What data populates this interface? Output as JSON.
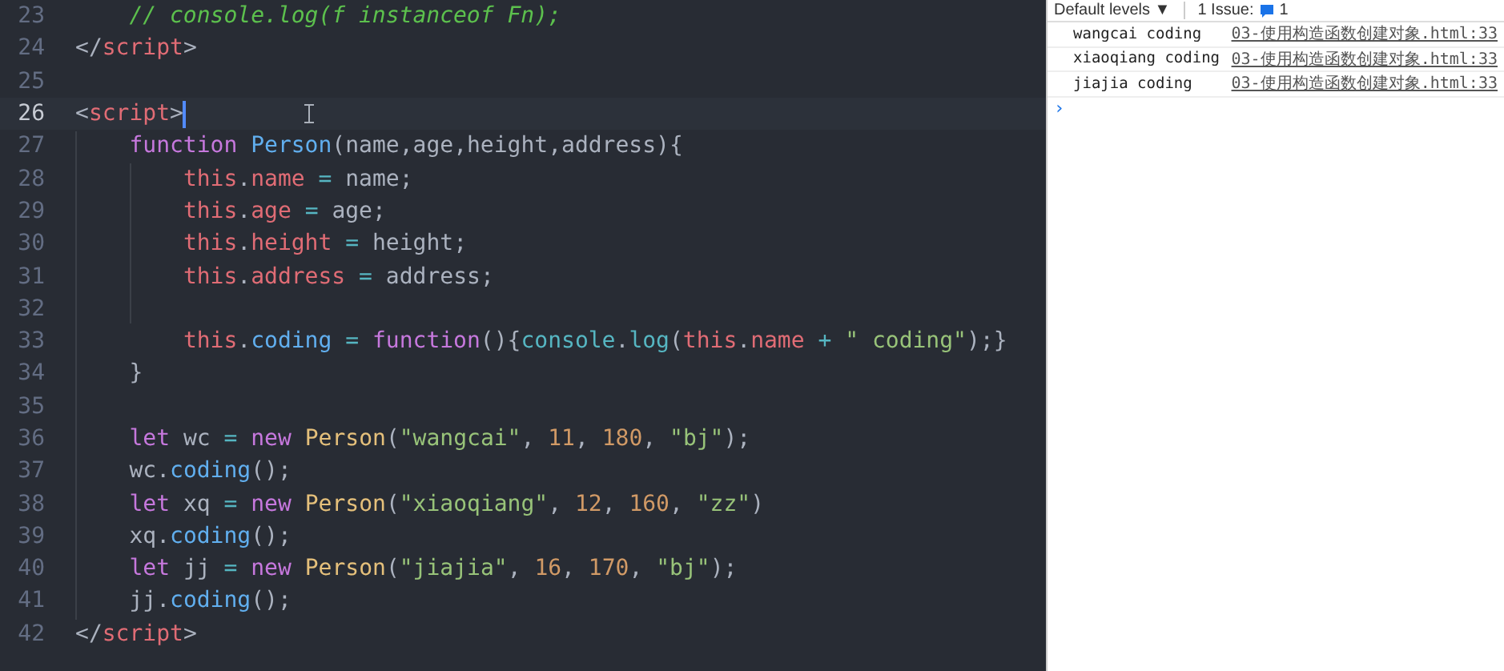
{
  "editor": {
    "lines": [
      {
        "number": "23",
        "current": false,
        "code": "    // console.log(f instanceof Fn);"
      },
      {
        "number": "24",
        "current": false,
        "code": "</script>"
      },
      {
        "number": "25",
        "current": false
      },
      {
        "number": "26",
        "current": true,
        "code": "<script>"
      },
      {
        "number": "27",
        "current": false,
        "code": "    function Person(name,age,height,address){"
      },
      {
        "number": "28",
        "current": false,
        "code": "        this.name = name;"
      },
      {
        "number": "29",
        "current": false,
        "code": "        this.age = age;"
      },
      {
        "number": "30",
        "current": false,
        "code": "        this.height = height;"
      },
      {
        "number": "31",
        "current": false,
        "code": "        this.address = address;"
      },
      {
        "number": "32",
        "current": false
      },
      {
        "number": "33",
        "current": false,
        "code": "        this.coding = function(){console.log(this.name + \" coding\");}"
      },
      {
        "number": "34",
        "current": false,
        "code": "    }"
      },
      {
        "number": "35",
        "current": false
      },
      {
        "number": "36",
        "current": false,
        "code": "    let wc = new Person(\"wangcai\", 11, 180, \"bj\");"
      },
      {
        "number": "37",
        "current": false,
        "code": "    wc.coding();"
      },
      {
        "number": "38",
        "current": false,
        "code": "    let xq = new Person(\"xiaoqiang\", 12, 160, \"zz\")"
      },
      {
        "number": "39",
        "current": false,
        "code": "    xq.coding();"
      },
      {
        "number": "40",
        "current": false,
        "code": "    let jj = new Person(\"jiajia\", 16, 170, \"bj\");"
      },
      {
        "number": "41",
        "current": false,
        "code": "    jj.coding();"
      },
      {
        "number": "42",
        "current": false,
        "code": "</script>"
      }
    ]
  },
  "console": {
    "toolbar": {
      "levels": "Default levels",
      "levels_caret": "▼",
      "issues_label": "1 Issue:",
      "issues_count": "1"
    },
    "messages": [
      {
        "text": "wangcai coding",
        "source": "03-使用构造函数创建对象.html:33"
      },
      {
        "text": "xiaoqiang coding",
        "source": "03-使用构造函数创建对象.html:33"
      },
      {
        "text": "jiajia coding",
        "source": "03-使用构造函数创建对象.html:33"
      }
    ],
    "prompt": "›"
  }
}
